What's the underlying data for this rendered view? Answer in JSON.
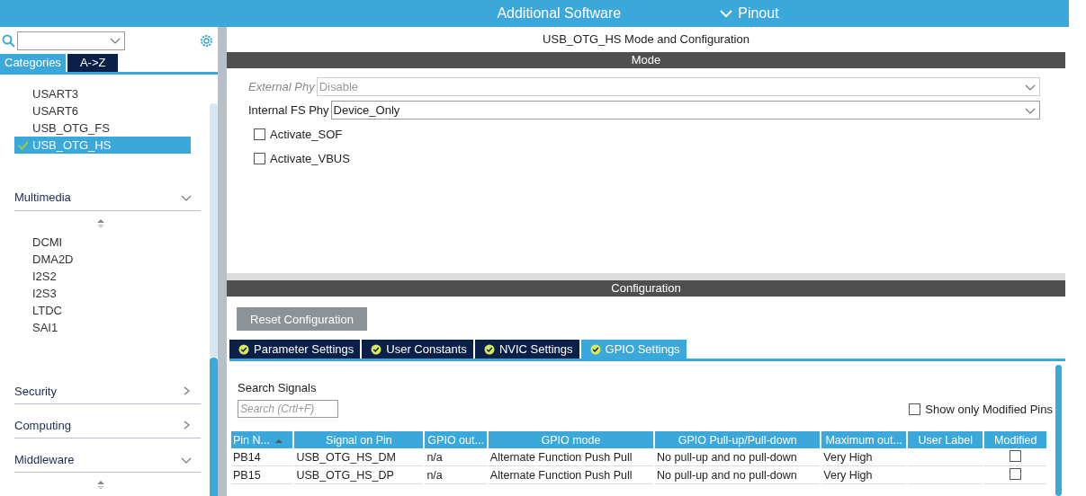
{
  "top_bar": {
    "items": [
      {
        "label": "Additional Software",
        "kind": "plain"
      },
      {
        "label": "Pinout",
        "kind": "dropdown"
      }
    ]
  },
  "sidebar": {
    "view_tabs": [
      {
        "label": "Categories",
        "selected": true
      },
      {
        "label": "A->Z",
        "selected": false
      }
    ],
    "peripherals": [
      {
        "label": "USART3",
        "selected": false,
        "enabled": false
      },
      {
        "label": "USART6",
        "selected": false,
        "enabled": false
      },
      {
        "label": "USB_OTG_FS",
        "selected": false,
        "enabled": false
      },
      {
        "label": "USB_OTG_HS",
        "selected": true,
        "enabled": true
      }
    ],
    "categories": [
      {
        "label": "Multimedia",
        "expanded": true,
        "items": [
          "DCMI",
          "DMA2D",
          "I2S2",
          "I2S3",
          "LTDC",
          "SAI1"
        ]
      },
      {
        "label": "Security",
        "expanded": false
      },
      {
        "label": "Computing",
        "expanded": false
      },
      {
        "label": "Middleware",
        "expanded": true
      }
    ]
  },
  "panel": {
    "title": "USB_OTG_HS Mode and Configuration",
    "mode": {
      "header": "Mode",
      "fields": [
        {
          "label": "External Phy",
          "value": "Disable",
          "disabled": true
        },
        {
          "label": "Internal FS Phy",
          "value": "Device_Only",
          "disabled": false
        }
      ],
      "checkboxes": [
        {
          "label": "Activate_SOF",
          "checked": false
        },
        {
          "label": "Activate_VBUS",
          "checked": false
        }
      ]
    },
    "configuration": {
      "header": "Configuration",
      "reset_button": "Reset Configuration",
      "tabs": [
        {
          "label": "Parameter Settings",
          "selected": false
        },
        {
          "label": "User Constants",
          "selected": false
        },
        {
          "label": "NVIC Settings",
          "selected": false
        },
        {
          "label": "GPIO Settings",
          "selected": true
        }
      ],
      "search_label": "Search Signals",
      "search_placeholder": "Search (Crtl+F)",
      "show_modified": {
        "label": "Show only Modified Pins",
        "checked": false
      },
      "table": {
        "columns": [
          "Pin N...",
          "Signal on Pin",
          "GPIO out...",
          "GPIO mode",
          "GPIO Pull-up/Pull-down",
          "Maximum out...",
          "User Label",
          "Modified"
        ],
        "rows": [
          {
            "cells": [
              "PB14",
              "USB_OTG_HS_DM",
              "n/a",
              "Alternate Function Push Pull",
              "No pull-up and no pull-down",
              "Very High",
              ""
            ],
            "modified": false
          },
          {
            "cells": [
              "PB15",
              "USB_OTG_HS_DP",
              "n/a",
              "Alternate Function Push Pull",
              "No pull-up and no pull-down",
              "Very High",
              ""
            ],
            "modified": false
          }
        ]
      }
    }
  }
}
